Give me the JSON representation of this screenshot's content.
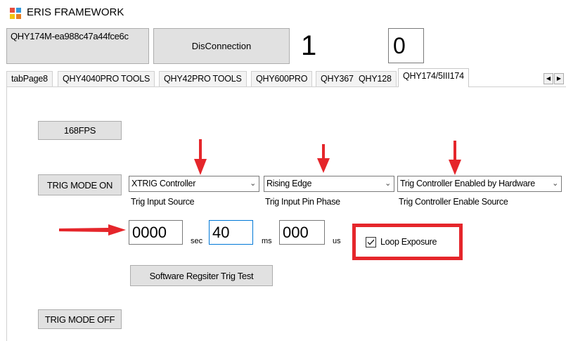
{
  "window": {
    "title": "ERIS FRAMEWORK",
    "icon": "app-window-icon"
  },
  "top_row": {
    "connection_name": "QHY174M-ea988c47a44fce6c",
    "disconnect_label": "DisConnection",
    "big_number_left": "1",
    "big_number_right": "0"
  },
  "tabs": [
    {
      "label": "tabPage8",
      "active": false
    },
    {
      "label": "QHY4040PRO TOOLS",
      "active": false
    },
    {
      "label": "QHY42PRO TOOLS",
      "active": false
    },
    {
      "label": "QHY600PRO",
      "active": false
    },
    {
      "label": "QHY367",
      "active": false
    },
    {
      "label": "QHY128",
      "active": false
    },
    {
      "label": "QHY174/5III174",
      "active": true
    }
  ],
  "tab_scroll": {
    "left": "◀",
    "right": "▶"
  },
  "panel": {
    "btn_168fps": "168FPS",
    "btn_trig_on": "TRIG MODE ON",
    "btn_trig_off": "TRIG MODE OFF",
    "btn_sw_trig": "Software Regsiter Trig Test",
    "combos": {
      "input_source": {
        "value": "XTRIG Controller",
        "label": "Trig Input Source"
      },
      "pin_phase": {
        "value": "Rising Edge",
        "label": "Trig Input Pin Phase"
      },
      "enable_source": {
        "value": "Trig Controller Enabled by Hardware",
        "label": "Trig Controller Enable Source"
      }
    },
    "exposure": {
      "sec_value": "0000",
      "sec_unit": "sec",
      "ms_value": "40",
      "ms_unit": "ms",
      "us_value": "000",
      "us_unit": "us"
    },
    "loop_exposure": {
      "label": "Loop Exposure",
      "checked": true
    }
  },
  "colors": {
    "annotation_red": "#e5262b",
    "focus_blue": "#0078d7",
    "button_gray": "#e1e1e1"
  }
}
